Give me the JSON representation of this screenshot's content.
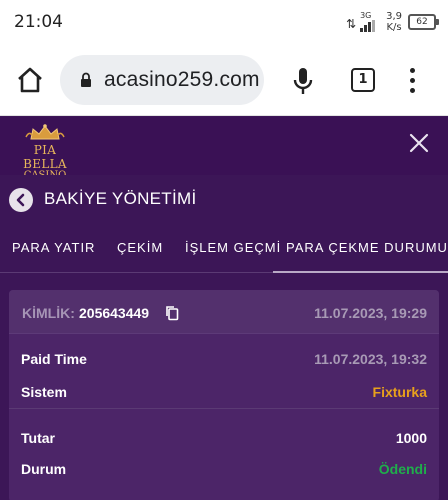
{
  "status_bar": {
    "time": "21:04",
    "network": "3G",
    "speed_value": "3,9",
    "speed_unit": "K/s",
    "battery_level": "62"
  },
  "browser": {
    "url": "acasino259.com",
    "tab_count": "1"
  },
  "site": {
    "logo_brand": "PIA BELLA",
    "logo_sub": "CASINO"
  },
  "panel": {
    "title": "BAKİYE YÖNETİMİ",
    "tabs": [
      {
        "label": "PARA YATIR",
        "active": false
      },
      {
        "label": "ÇEKİM",
        "active": false
      },
      {
        "label": "İŞLEM GEÇMİ",
        "active": false
      },
      {
        "label": "PARA ÇEKME DURUMU",
        "active": true
      }
    ]
  },
  "withdrawal": {
    "id_label": "KİMLİK:",
    "id_value": "205643449",
    "created_at": "11.07.2023, 19:29",
    "paid_time_label": "Paid Time",
    "paid_time_value": "11.07.2023, 19:32",
    "system_label": "Sistem",
    "system_value": "Fixturka",
    "amount_label": "Tutar",
    "amount_value": "1000",
    "status_label": "Durum",
    "status_value": "Ödendi"
  },
  "colors": {
    "background": "#3c1657",
    "header": "#3a1155",
    "card": "#4c2568",
    "system_accent": "#e8a11c",
    "status_paid": "#1fae4b",
    "logo_gold": "#e8b65b"
  }
}
